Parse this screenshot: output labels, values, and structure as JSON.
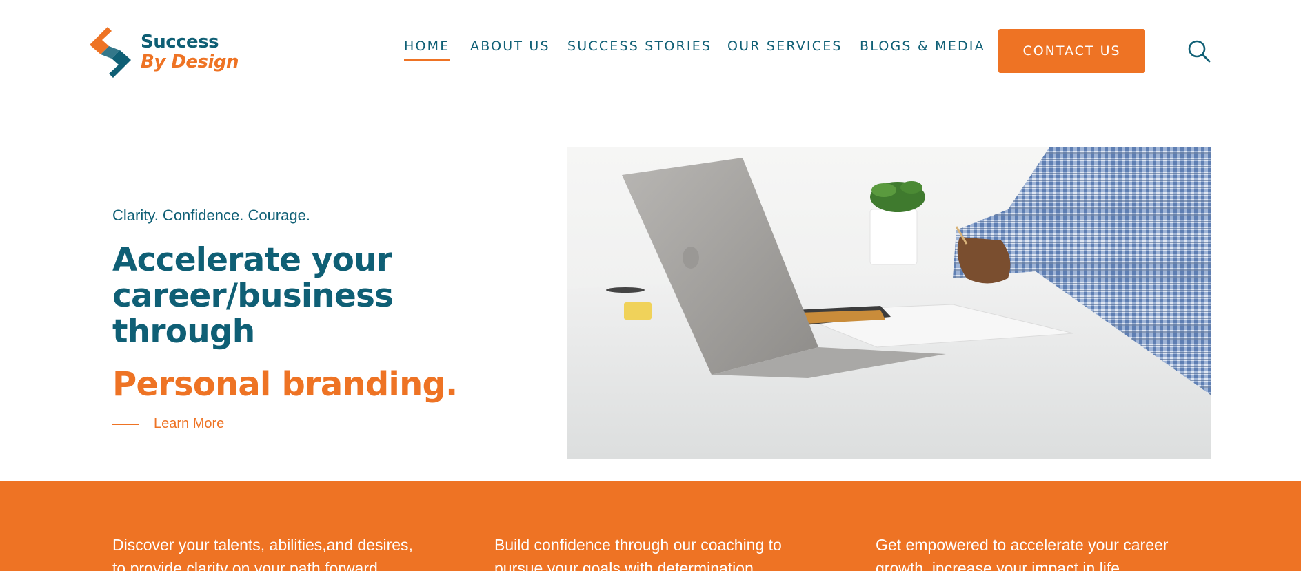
{
  "brand": {
    "line1": "Success",
    "line2": "By Design",
    "colors": {
      "primary": "#0f5f75",
      "accent": "#ee7324"
    }
  },
  "nav": {
    "items": [
      {
        "label": "HOME",
        "active": true
      },
      {
        "label": "ABOUT US",
        "active": false
      },
      {
        "label": "SUCCESS STORIES",
        "active": false
      },
      {
        "label": "OUR SERVICES",
        "active": false
      },
      {
        "label": "BLOGS & MEDIA",
        "active": false
      }
    ],
    "cta": "CONTACT US",
    "search_icon": "search-icon"
  },
  "hero": {
    "tagline": "Clarity. Confidence. Courage.",
    "headline_line1": "Accelerate your",
    "headline_line2": "career/business through",
    "highlight": "Personal branding.",
    "link": "Learn More"
  },
  "band": {
    "columns": [
      {
        "line1": "Discover your talents, abilities,and desires,",
        "line2": "to provide clarity on your path forward."
      },
      {
        "line1": "Build confidence through our coaching to",
        "line2": "pursue your goals with determination."
      },
      {
        "line1": "Get empowered to accelerate your career",
        "line2": "growth, increase your impact in life."
      }
    ]
  }
}
